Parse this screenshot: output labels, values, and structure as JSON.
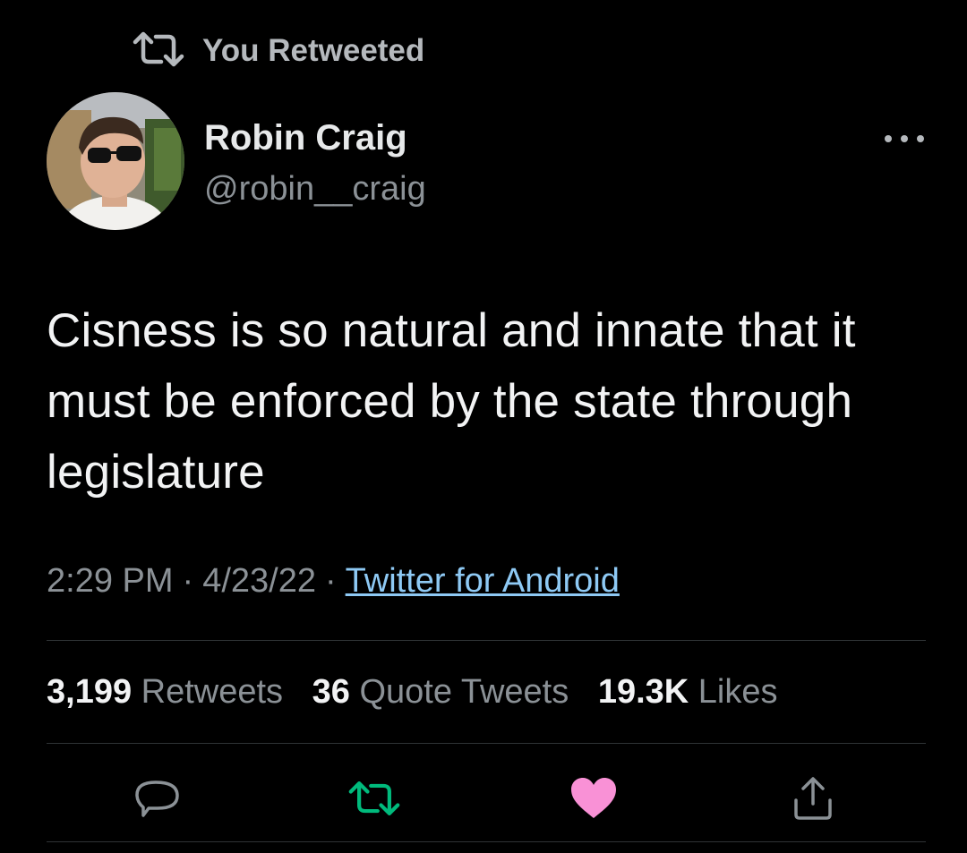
{
  "retweet_notice": {
    "label": "You Retweeted"
  },
  "author": {
    "name": "Robin Craig",
    "handle": "@robin__craig"
  },
  "tweet": {
    "text": "Cisness is so natural and innate that it must be enforced by the state through legislature",
    "time": "2:29 PM",
    "date": "4/23/22",
    "separator": "·",
    "source": "Twitter for Android"
  },
  "stats": {
    "retweets_count": "3,199",
    "retweets_label": "Retweets",
    "quotes_count": "36",
    "quotes_label": "Quote Tweets",
    "likes_count": "19.3K",
    "likes_label": "Likes"
  },
  "actions": [
    {
      "icon": "reply-icon",
      "state": "default"
    },
    {
      "icon": "retweet-icon",
      "state": "active",
      "color": "#00ba7c"
    },
    {
      "icon": "heart-icon",
      "state": "active",
      "color": "#f91880"
    },
    {
      "icon": "share-icon",
      "state": "default"
    }
  ],
  "colors": {
    "background": "#000000",
    "link": "#8ec9f4",
    "retweet_active": "#00ba7c",
    "like_active": "#f991d6",
    "muted": "#8b9196"
  }
}
